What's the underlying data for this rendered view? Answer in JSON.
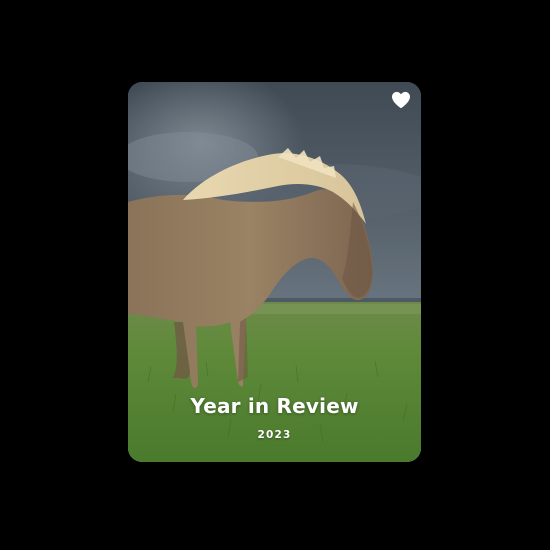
{
  "card": {
    "title": "Year in Review",
    "year": "2023",
    "favorite_icon": "heart-icon",
    "image_subject": "horse-photo"
  },
  "colors": {
    "background": "#000000",
    "text": "#ffffff",
    "heart": "#ffffff"
  }
}
